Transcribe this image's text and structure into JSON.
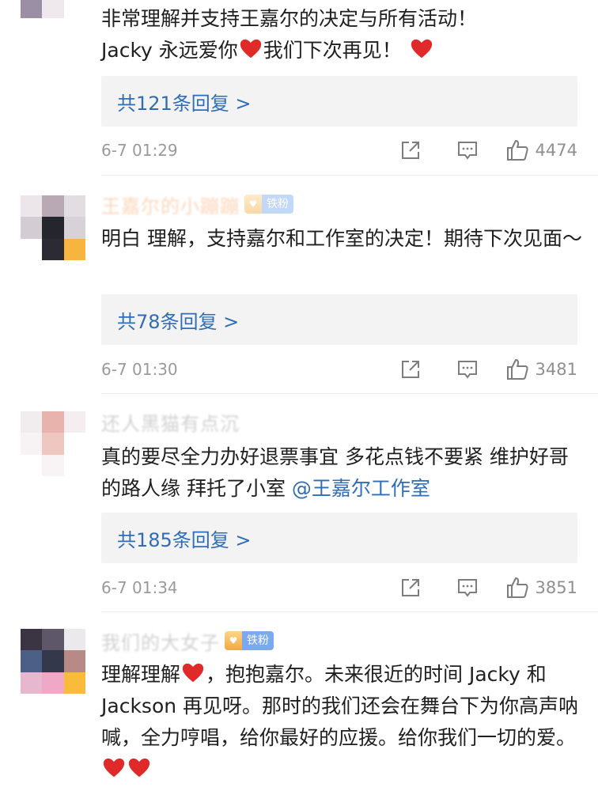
{
  "comments": [
    {
      "username": "",
      "text_line1": "非常理解并支持王嘉尔的决定与所有活动！",
      "text_line2_a": "Jacky 永远爱你",
      "text_line2_b": "我们下次再见！",
      "reply_label": "共121条回复 >",
      "time": "6-7 01:29",
      "likes": "4474"
    },
    {
      "username": "王嘉尔的小蹦蹦",
      "badge": "铁粉",
      "text": "明白 理解，支持嘉尔和工作室的决定！期待下次见面～",
      "reply_label": "共78条回复 >",
      "time": "6-7 01:30",
      "likes": "3481"
    },
    {
      "username": "还人黑猫有点沉",
      "text_a": "真的要尽全力办好退票事宜 多花点钱不要紧 维护好哥的路人缘 拜托了小室 ",
      "mention": "@王嘉尔工作室",
      "reply_label": "共185条回复 >",
      "time": "6-7 01:34",
      "likes": "3851"
    },
    {
      "username": "我们的大女子",
      "badge": "铁粉",
      "text_a": "理解理解",
      "text_b": "，抱抱嘉尔。未来很近的时间 Jacky 和 Jackson 再见呀。那时的我们还会在舞台下为你高声呐喊，全力哼唱，给你最好的应援。给你我们一切的爱。"
    }
  ],
  "colors": {
    "link": "#2f6db8",
    "heart": "#e02a2a",
    "username_orange": "#f28a38",
    "badge_blue": "#7aa9f0",
    "reply_bg": "#f3f3f3"
  },
  "icons": {
    "share": "share-icon",
    "comment": "comment-icon",
    "like": "thumbs-up-icon",
    "heart": "heart-icon"
  }
}
